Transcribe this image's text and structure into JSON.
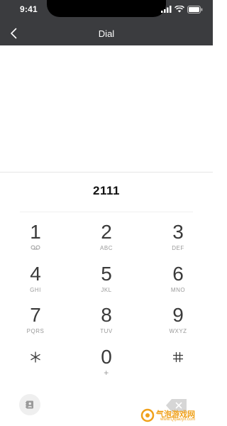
{
  "status_bar": {
    "time": "9:41",
    "icons": [
      "signal-icon",
      "wifi-icon",
      "battery-icon"
    ]
  },
  "header": {
    "title": "Dial",
    "back_icon": "chevron-left-icon"
  },
  "dialer": {
    "number": "2111"
  },
  "keypad": [
    {
      "digit": "1",
      "sub": "voicemail-icon"
    },
    {
      "digit": "2",
      "sub": "ABC"
    },
    {
      "digit": "3",
      "sub": "DEF"
    },
    {
      "digit": "4",
      "sub": "GHI"
    },
    {
      "digit": "5",
      "sub": "JKL"
    },
    {
      "digit": "6",
      "sub": "MNO"
    },
    {
      "digit": "7",
      "sub": "PQRS"
    },
    {
      "digit": "8",
      "sub": "TUV"
    },
    {
      "digit": "9",
      "sub": "WXYZ"
    },
    {
      "digit": "*",
      "sub": ""
    },
    {
      "digit": "0",
      "sub": "+"
    },
    {
      "digit": "#",
      "sub": ""
    }
  ],
  "bottom": {
    "contacts_icon": "contacts-icon",
    "backspace_icon": "backspace-icon"
  },
  "watermark": {
    "text": "气泡游戏网",
    "url": "www.Qipaoyx.com"
  },
  "colors": {
    "header_bg": "#3b3c3f",
    "digit": "#3a3a3a",
    "sub": "#9a9a9a",
    "watermark": "#f0a11b"
  }
}
